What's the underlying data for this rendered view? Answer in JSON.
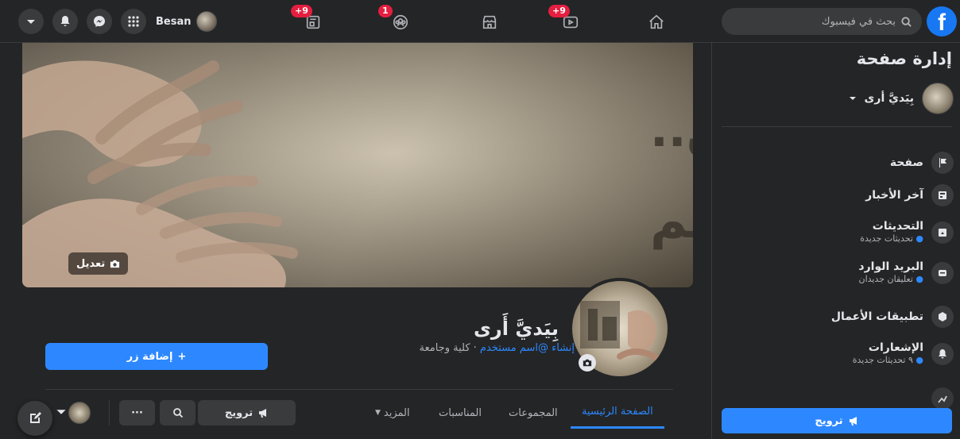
{
  "topbar": {
    "profile_name": "Besan",
    "search_placeholder": "بحث في فيسبوك",
    "badges": {
      "nav_1": "+9",
      "nav_2": "1",
      "nav_4": "+9"
    }
  },
  "sidebar": {
    "title": "إدارة صفحة",
    "page_name": "بِيَديَّ أرى",
    "items": [
      {
        "label": "صفحة"
      },
      {
        "label": "آخر الأخبار"
      },
      {
        "label": "التحديثات",
        "sub": "تحديثات جديدة"
      },
      {
        "label": "البريد الوارد",
        "sub": "تعليقان جديدان"
      },
      {
        "label": "تطبيقات الأعمال"
      },
      {
        "label": "الإشعارات",
        "sub": "٩ تحديثات جديدة"
      }
    ],
    "promote_label": "ترويج"
  },
  "cover": {
    "edit_label": "تعديل",
    "artwork_text_line1": "تخلق الفن..",
    "artwork_text_line2": "نغوص في الحلم"
  },
  "page": {
    "name": "بِيَديَّ أَرى",
    "create_username": "إنشاء @اسم مستخدم",
    "category": " · كلية وجامعة",
    "add_button": "إضافة زر"
  },
  "tabs": {
    "home": "الصفحة الرئيسية",
    "groups": "المجموعات",
    "events": "المناسبات",
    "more": "المزيد"
  },
  "actions": {
    "promote": "ترويج",
    "more": "···"
  }
}
